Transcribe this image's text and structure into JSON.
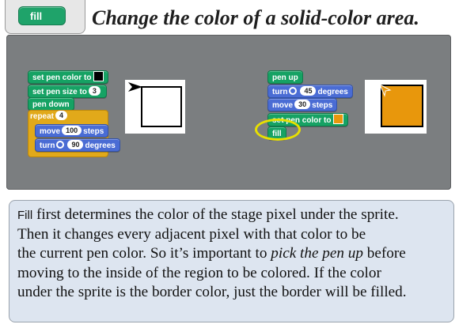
{
  "header": {
    "fill_block_label": "fill",
    "title": "Change the color of a solid-color area."
  },
  "left_script": {
    "set_pen_color_label": "set pen color to",
    "set_pen_color_swatch": "#000000",
    "set_pen_size_label": "set pen size to",
    "set_pen_size_value": "3",
    "pen_down_label": "pen down",
    "repeat_label": "repeat",
    "repeat_value": "4",
    "move_label": "move",
    "move_value": "100",
    "move_suffix": "steps",
    "turn_label": "turn",
    "turn_value": "90",
    "turn_suffix": "degrees"
  },
  "right_script": {
    "pen_up_label": "pen up",
    "turn_label": "turn",
    "turn_value": "45",
    "turn_suffix": "degrees",
    "move_label": "move",
    "move_value": "30",
    "move_suffix": "steps",
    "set_pen_color_label": "set pen color to",
    "set_pen_color_swatch": "#e8970c",
    "fill_label": "fill"
  },
  "stages": {
    "left": {
      "shape": "outlined-square",
      "fill": "#ffffff"
    },
    "right": {
      "shape": "filled-square",
      "fill": "#e8970c"
    }
  },
  "explanation": {
    "keyword": "Fill",
    "line1": " first determines the color of the stage pixel under the sprite.",
    "line2": "Then it changes every adjacent pixel with that color to be",
    "line3a": "the current pen color.  So it’s important to ",
    "line3_emph": "pick the pen up",
    "line3b": " before",
    "line4": "moving to the inside of the region to be colored.  If the color",
    "line5": "under the sprite is the border color, just the border will be filled."
  },
  "colors": {
    "pen_block": "#16a264",
    "motion_block": "#4a6cd4",
    "control_block": "#e1a91a",
    "highlight_ring": "#e8e000"
  }
}
